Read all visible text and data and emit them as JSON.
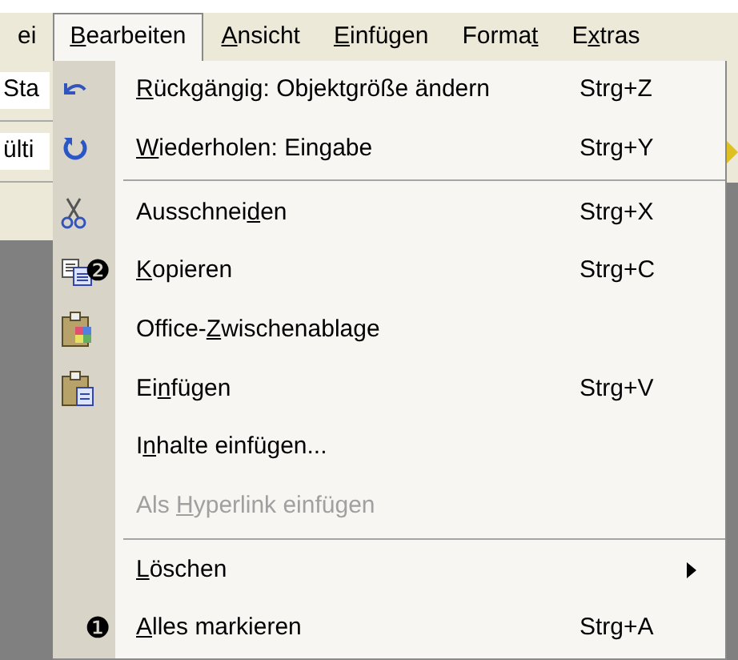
{
  "menubar": [
    {
      "label": {
        "pre": "ei"
      },
      "selected": false
    },
    {
      "label": {
        "key": "B",
        "post": "earbeiten"
      },
      "selected": true
    },
    {
      "label": {
        "key": "A",
        "post": "nsicht"
      },
      "selected": false
    },
    {
      "label": {
        "key": "E",
        "post": "infügen"
      },
      "selected": false
    },
    {
      "label": {
        "pre": "Forma",
        "key": "t"
      },
      "selected": false
    },
    {
      "label": {
        "pre": "E",
        "key": "x",
        "post": "tras"
      },
      "selected": false
    }
  ],
  "background_fragments": [
    "Sta",
    "ülti"
  ],
  "menu": [
    {
      "kind": "item",
      "label": {
        "key": "R",
        "post": "ückgängig: Objektgröße ändern"
      },
      "shortcut": "Strg+Z",
      "disabled": false
    },
    {
      "kind": "item",
      "label": {
        "key": "W",
        "post": "iederholen: Eingabe"
      },
      "shortcut": "Strg+Y",
      "disabled": false
    },
    {
      "kind": "separator"
    },
    {
      "kind": "item",
      "label": {
        "pre": "Ausschnei",
        "key": "d",
        "post": "en"
      },
      "shortcut": "Strg+X",
      "disabled": false
    },
    {
      "kind": "item",
      "label": {
        "key": "K",
        "post": "opieren"
      },
      "shortcut": "Strg+C",
      "disabled": false,
      "callout": "❷"
    },
    {
      "kind": "item",
      "label": {
        "pre": "Office-",
        "key": "Z",
        "post": "wischenablage"
      },
      "disabled": false
    },
    {
      "kind": "item",
      "label": {
        "pre": "Ei",
        "key": "n",
        "post": "fügen"
      },
      "shortcut": "Strg+V",
      "disabled": false
    },
    {
      "kind": "item",
      "label": {
        "pre": "I",
        "key": "n",
        "post": "halte einfügen..."
      },
      "disabled": false
    },
    {
      "kind": "item",
      "label": {
        "pre": "Als ",
        "key": "H",
        "post": "yperlink einfügen"
      },
      "disabled": true
    },
    {
      "kind": "separator"
    },
    {
      "kind": "item",
      "label": {
        "key": "L",
        "post": "öschen"
      },
      "disabled": false,
      "submenu": true
    },
    {
      "kind": "item",
      "label": {
        "key": "A",
        "post": "lles markieren"
      },
      "shortcut": "Strg+A",
      "disabled": false,
      "callout": "❶"
    }
  ]
}
